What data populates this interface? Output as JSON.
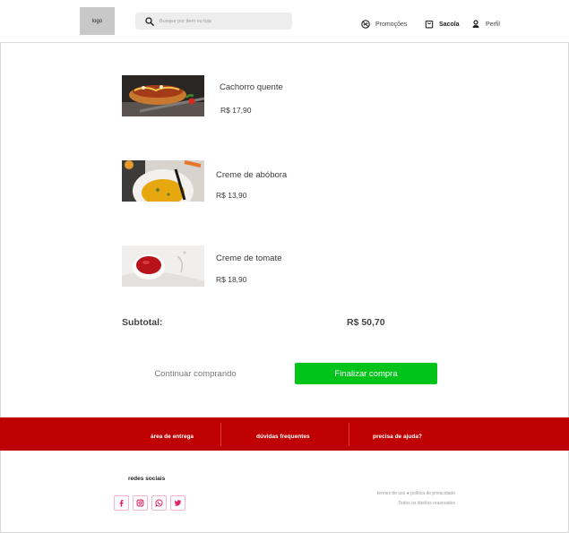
{
  "header": {
    "logo_text": "logo",
    "search_placeholder": "Busque por item ou loja",
    "nav": {
      "promotions": "Promoções",
      "bag": "Sacola",
      "profile": "Perfil"
    }
  },
  "cart": {
    "items": [
      {
        "name": "Cachorro quente",
        "price": "R$ 17,90",
        "image": "hot-dog"
      },
      {
        "name": "Creme de abóbora",
        "price": "R$ 13,90",
        "image": "pumpkin-soup"
      },
      {
        "name": "Creme de tomate",
        "price": "R$ 18,90",
        "image": "tomato-soup"
      }
    ],
    "subtotal_label": "Subtotal:",
    "subtotal_value": "R$ 50,70",
    "continue_label": "Continuar comprando",
    "checkout_label": "Finalizar compra"
  },
  "band": {
    "links": [
      "área de entrega",
      "dúvidas frequentes",
      "precisa de ajuda?"
    ]
  },
  "footer": {
    "social_title": "redes sociais",
    "social_icons": [
      "facebook-icon",
      "instagram-icon",
      "whatsapp-icon",
      "twitter-icon"
    ],
    "terms": "termos de uso",
    "privacy": "política de privacidade",
    "rights": "Todos os direitos reservados"
  },
  "colors": {
    "accent_green": "#00c41a",
    "band_red": "#bf0000",
    "social_pink": "#e0245e"
  }
}
